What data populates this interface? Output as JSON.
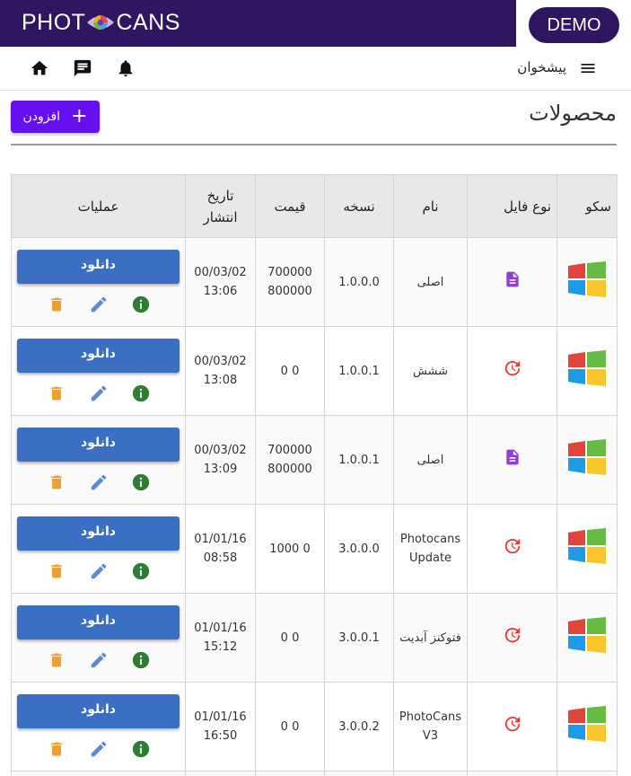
{
  "brand": {
    "logo_left": "PHOT",
    "logo_right": "CANS",
    "demo_label": "DEMO"
  },
  "colors": {
    "brand_bar": "#2e1760",
    "add_button": "#6610f2",
    "download_button": "#3a6fc4",
    "info_icon": "#2e7d32",
    "edit_icon": "#5b8bd8",
    "delete_icon": "#f0a030",
    "file_icon": "#8e3fd1",
    "update_icon": "#e53935"
  },
  "navbar": {
    "dashboard_label": "پیشخوان",
    "icons": [
      "menu-icon",
      "bell-icon",
      "message-icon",
      "home-icon"
    ]
  },
  "page": {
    "title": "محصولات",
    "add_label": "افزودن"
  },
  "table": {
    "headers": {
      "sku": "سکو",
      "file_type": "نوع فایل",
      "name": "نام",
      "version": "نسخه",
      "price": "قیمت",
      "date_line1": "تاریخ",
      "date_line2": "انتشار",
      "ops": "عملیات"
    },
    "rows": [
      {
        "platform": "windows",
        "file_icon": "file-icon",
        "name_line1": "اصلی",
        "name_line2": "",
        "version": "1.0.0.0",
        "price_line1": "700000",
        "price_line2": "800000",
        "date": "00/03/02",
        "time": "13:06",
        "download": "دانلود"
      },
      {
        "platform": "windows",
        "file_icon": "update-icon",
        "name_line1": "ششش",
        "name_line2": "",
        "version": "1.0.0.1",
        "price_line1": "0 0",
        "price_line2": "",
        "date": "00/03/02",
        "time": "13:08",
        "download": "دانلود"
      },
      {
        "platform": "windows",
        "file_icon": "file-icon",
        "name_line1": "اصلی",
        "name_line2": "",
        "version": "1.0.0.1",
        "price_line1": "700000",
        "price_line2": "800000",
        "date": "00/03/02",
        "time": "13:09",
        "download": "دانلود"
      },
      {
        "platform": "windows",
        "file_icon": "update-icon",
        "name_line1": "Photocans",
        "name_line2": "Update",
        "version": "3.0.0.0",
        "price_line1": "0 1000",
        "price_line2": "",
        "date": "01/01/16",
        "time": "08:58",
        "download": "دانلود"
      },
      {
        "platform": "windows",
        "file_icon": "update-icon",
        "name_line1": "فتوکنز آبدیت",
        "name_line2": "",
        "version": "3.0.0.1",
        "price_line1": "0 0",
        "price_line2": "",
        "date": "01/01/16",
        "time": "15:12",
        "download": "دانلود"
      },
      {
        "platform": "windows",
        "file_icon": "update-icon",
        "name_line1": "PhotoCans",
        "name_line2": "V3",
        "version": "3.0.0.2",
        "price_line1": "0 0",
        "price_line2": "",
        "date": "01/01/16",
        "time": "16:50",
        "download": "دانلود"
      }
    ]
  }
}
